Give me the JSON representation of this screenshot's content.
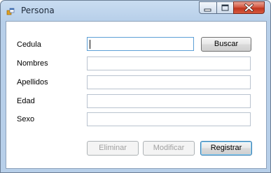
{
  "window": {
    "title": "Persona",
    "controls": {
      "minimize": "minimize-icon",
      "maximize": "maximize-icon",
      "close": "close-icon"
    }
  },
  "form": {
    "cedula": {
      "label": "Cedula",
      "value": "",
      "search_label": "Buscar"
    },
    "nombres": {
      "label": "Nombres",
      "value": ""
    },
    "apellidos": {
      "label": "Apellidos",
      "value": ""
    },
    "edad": {
      "label": "Edad",
      "value": ""
    },
    "sexo": {
      "label": "Sexo",
      "value": ""
    }
  },
  "actions": {
    "eliminar": "Eliminar",
    "modificar": "Modificar",
    "registrar": "Registrar"
  },
  "colors": {
    "titlebar": "#c9dcf1",
    "close_button": "#c0361f",
    "focus_border": "#5c9fd6"
  }
}
